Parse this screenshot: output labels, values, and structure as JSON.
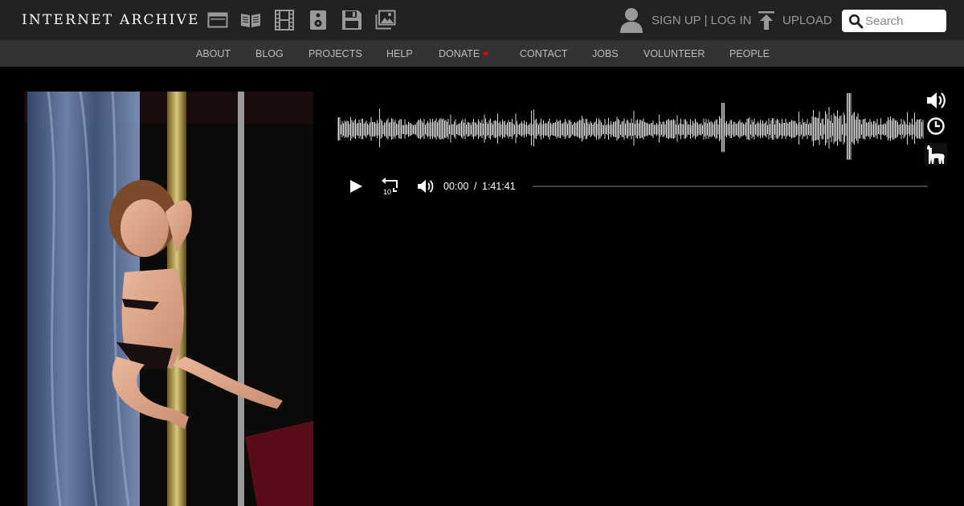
{
  "brand": {
    "name": "INTERNET ARCHIVE"
  },
  "header": {
    "media_icons": [
      "web-archive-icon",
      "texts-icon",
      "video-icon",
      "audio-icon",
      "software-icon",
      "images-icon"
    ],
    "signup_label": "SIGN UP",
    "separator": "|",
    "login_label": "LOG IN",
    "upload_label": "UPLOAD",
    "search_placeholder": "Search"
  },
  "nav": {
    "items": [
      "ABOUT",
      "BLOG",
      "PROJECTS",
      "HELP",
      "DONATE",
      "CONTACT",
      "JOBS",
      "VOLUNTEER",
      "PEOPLE"
    ],
    "donate_heart": "♥"
  },
  "player": {
    "current_time": "00:00",
    "time_separator": "/",
    "duration": "1:41:41",
    "progress": 0,
    "side_icons": [
      "volume-icon",
      "clock-icon",
      "llama-icon"
    ],
    "controls": [
      "play-icon",
      "rewind-10-icon",
      "volume-icon"
    ],
    "rewind_seconds": "10"
  },
  "colors": {
    "topbar": "#222222",
    "navbar": "#333333",
    "background": "#000000",
    "heart": "#ee0000",
    "waveform": "#d8d8d8"
  }
}
